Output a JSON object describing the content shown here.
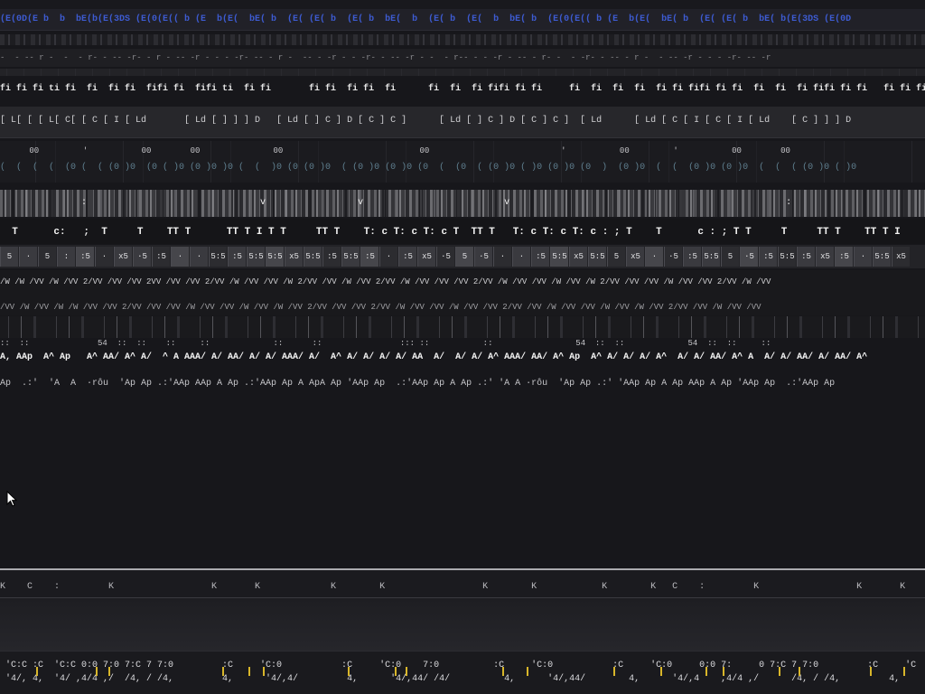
{
  "screen": {
    "top_strip_text": "(E(0D(E b  b  bE(b(E(3DS (E(0(E(( b (E  b(E(  bE( b  (E( (E( b  (E( b  bE(  b  (E( b  (E(  b  bE( b  (E(0(E(( b (E  b(E(  bE( b  (E( (E( b  bE( b(E(3DS (E(0D",
    "ruler_text": "-  - -- r -  -  - r- - -- -r- - r - -- -r - - - -r- -- - r -  -- - -r - - -r- - -- -r - -  - r-- - - -r - -- - r- -  - -r- - -- - r -  - -- -r - - - -r- -- -r",
    "fi_row_text": "fi fi fi ti fi  fi  fi fi  fifi fi  fifi ti  fi fi       fi fi  fi fi  fi      fi  fi  fi fifi fi fi     fi  fi  fi  fi  fi fi fifi fi fi  fi  fi  fi fifi fi fi   fi fi fi",
    "bracket_row_text": "[ L[ [ [ L[ C[ [ C [ I [ Ld       [ Ld [ ] ] ] D   [ Ld [ ] C ] D [ C ] C ]      [ Ld [ ] C ] D [ C ] C ]  [ Ld      [ Ld [ C [ I [ C [ I [ Ld    [ C ] ] ] D",
    "marker_row_text": "      00         '           00        00               00                            00                           '           00         '           00        00",
    "teal_row_text": "(  (  (  (  (0 (  ( (0 )0  (0 ( )0 (0 )0 )0 (  (  )0 (0 (0 )0  ( (0 )0 (0 )0 (0  (  (0  ( (0 )0 ( )0 (0 )0 (0  )  (0 )0  (  (  (0 )0 (0 )0  (  (  ( (0 )0 ( )0",
    "bar_row_glyphs": "               :                                v                 v                          v                                                   :",
    "t_row_text": "  T      c:   ;  T     T    TT T      TT T I T T     TT T    T: c T: c T: c T  TT T   T: c T: c T: c : ; T    T      c : ; T T     T     TT T    TT T I",
    "cell_labels": [
      "5",
      "·",
      "5",
      ":",
      ":5",
      "·",
      "x5",
      "·5",
      ":5",
      "·",
      "·",
      "5:5",
      ":5",
      "5:5",
      "5:5",
      "x5",
      "5:5",
      ":5",
      "5:5",
      ":5",
      "·",
      ":5",
      "x5",
      "·5",
      "5",
      "·5",
      "·",
      "·",
      ":5",
      "5:5",
      "x5",
      "5:5",
      "5",
      "x5",
      "·",
      "·5",
      ":5",
      "5:5",
      "5",
      "·5",
      ":5",
      "5:5",
      ":5",
      "x5",
      ":5",
      "·",
      "5:5",
      "x5"
    ],
    "wave_row_1_text": "/W /W /VV /W /VV 2/VV /VV /VV 2VV /VV /VV 2/VV /W /VV /VV /W 2/VV /VV /W /VV 2/VV /W /VV /VV /VV 2/VV /W /VV /VV /W /VV /W 2/VV /VV /VV /W /VV /VV 2/VV /W /VV",
    "wave_row_2_text": "/VV /W /VV /W /W /VV /VV 2/VV /VV /VV /W /VV /VV /W /VV /W /VV 2/VV /VV /VV 2/VV /W /VV /VV /W /VV /VV 2/VV /VV /W /VV /VV /W /VV /W /VV 2/VV /VV /W /VV /VV",
    "marks_row_text": "::  ::              54  ::  ::    ::     ::             ::      ::                ::: ::           ::                 54  ::  ::             54  ::  ::     ::",
    "aap_row_text": "A, AAp  A^ Ap   A^ AA/ A^ A/  ^ A AAA/ A/ AA/ A/ A/ AAA/ A/  A^ A/ A/ A/ A/ AA  A/  A/ A/ A^ AAA/ AA/ A^ Ap  A^ A/ A/ A/ A^  A/ A/ AA/ A^ A  A/ A/ AA/ A/ AA/ A^",
    "ap_row_text": "Ap  .:'  'A  A  ·rôu  'Ap Ap .:'AAp AAp A Ap .:'AAp Ap A ApA Ap 'AAp Ap  .:'AAp Ap A Ap .:' 'A A ·rôu  'Ap Ap .:' 'AAp Ap A Ap AAp A Ap 'AAp Ap  .:'AAp Ap",
    "transport_row_text": "K    C    :         K                  K       K             K        K                  K        K            K        K   C    :         K                  K       K",
    "timecode_row_1_text": " 'C:C :C  'C:C 0:0 7:0 7:C 7 7:0         :C     'C:0           :C     'C:0    7:0          :C     'C:0           :C     'C:0     0:0 7:     0 7:C 7 7:0         :C     'C",
    "timecode_row_2_text": " '4/, 4,  '4/ ,4/4 ,/  /4, / /4,         4,      '4/,4/         4,      '4/,44/ /4/          4,      '4/,44/        4,      '4/,4    ,4/4 ,/      /4, / /4,         4,      '4,"
  },
  "icons": {
    "cursor": "mouse-pointer-icon"
  },
  "colors": {
    "background": "#17171b",
    "accent_blue": "#3d5bd1",
    "teal_text": "#5f7f8f",
    "marker_yellow": "#d8b62a",
    "divider_light": "#ababaf"
  }
}
